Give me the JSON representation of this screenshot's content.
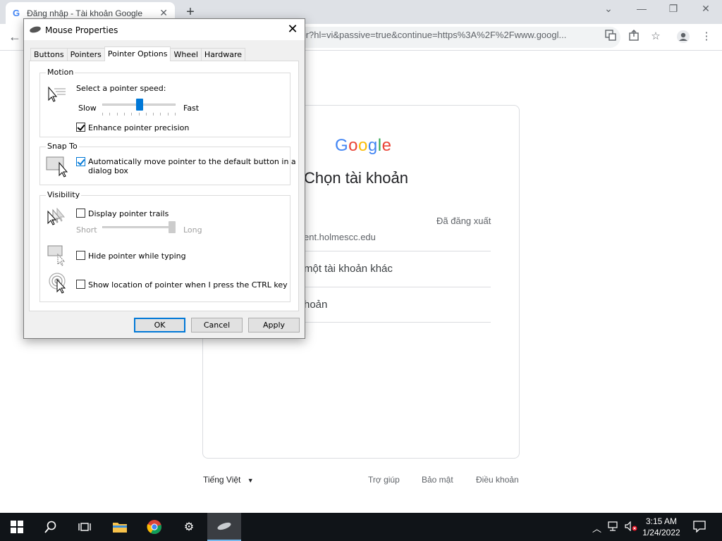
{
  "browser": {
    "tab_title": "Đăng nhập - Tài khoản Google",
    "favicon": "G",
    "url": "ser?hl=vi&passive=true&continue=https%3A%2F%2Fwww.googl..."
  },
  "google_page": {
    "logo_letters": [
      "G",
      "o",
      "o",
      "g",
      "l",
      "e"
    ],
    "logo_colors": [
      "#4285f4",
      "#ea4335",
      "#fbbc05",
      "#4285f4",
      "#34a853",
      "#ea4335"
    ],
    "heading": "Chọn tài khoản",
    "account_status": "Đã đăng xuất",
    "account_email": "ent.holmescc.edu",
    "option_other_account": "một tài khoản khác",
    "option_remove": "hoản",
    "footer": {
      "language": "Tiếng Việt",
      "help": "Trợ giúp",
      "privacy": "Bảo mật",
      "terms": "Điều khoản"
    }
  },
  "dialog": {
    "title": "Mouse Properties",
    "tabs": [
      "Buttons",
      "Pointers",
      "Pointer Options",
      "Wheel",
      "Hardware"
    ],
    "active_tab": "Pointer Options",
    "motion": {
      "group_label": "Motion",
      "speed_label": "Select a pointer speed:",
      "slow_label": "Slow",
      "fast_label": "Fast",
      "speed_level_fraction": 0.5,
      "enhance_label": "Enhance pointer precision",
      "enhance_checked": true
    },
    "snap_to": {
      "group_label": "Snap To",
      "auto_move_label_line1": "Automatically move pointer to the default button in a",
      "auto_move_label_line2": "dialog box",
      "auto_move_checked": true
    },
    "visibility": {
      "group_label": "Visibility",
      "trails_label": "Display pointer trails",
      "trails_checked": false,
      "short_label": "Short",
      "long_label": "Long",
      "trails_level_fraction": 1.0,
      "hide_label": "Hide pointer while typing",
      "hide_checked": false,
      "show_location_label": "Show location of pointer when I press the CTRL key",
      "show_location_checked": false
    },
    "buttons": {
      "ok": "OK",
      "cancel": "Cancel",
      "apply": "Apply"
    }
  },
  "taskbar": {
    "time": "3:15 AM",
    "date": "1/24/2022",
    "accent_color": "#76b9ed"
  }
}
